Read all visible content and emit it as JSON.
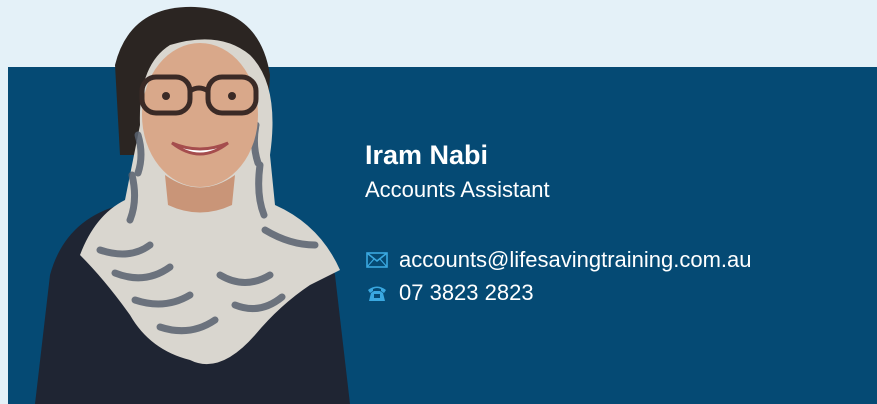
{
  "profile": {
    "name": "Iram Nabi",
    "role": "Accounts Assistant"
  },
  "contact": {
    "email": "accounts@lifesavingtraining.com.au",
    "phone": "07 3823 2823"
  },
  "icons": {
    "email": "envelope-icon",
    "phone": "telephone-icon"
  },
  "colors": {
    "page_background": "#e4f1f8",
    "card_background": "#054a74",
    "text": "#ffffff",
    "icon_accent": "#3aa8e0"
  }
}
